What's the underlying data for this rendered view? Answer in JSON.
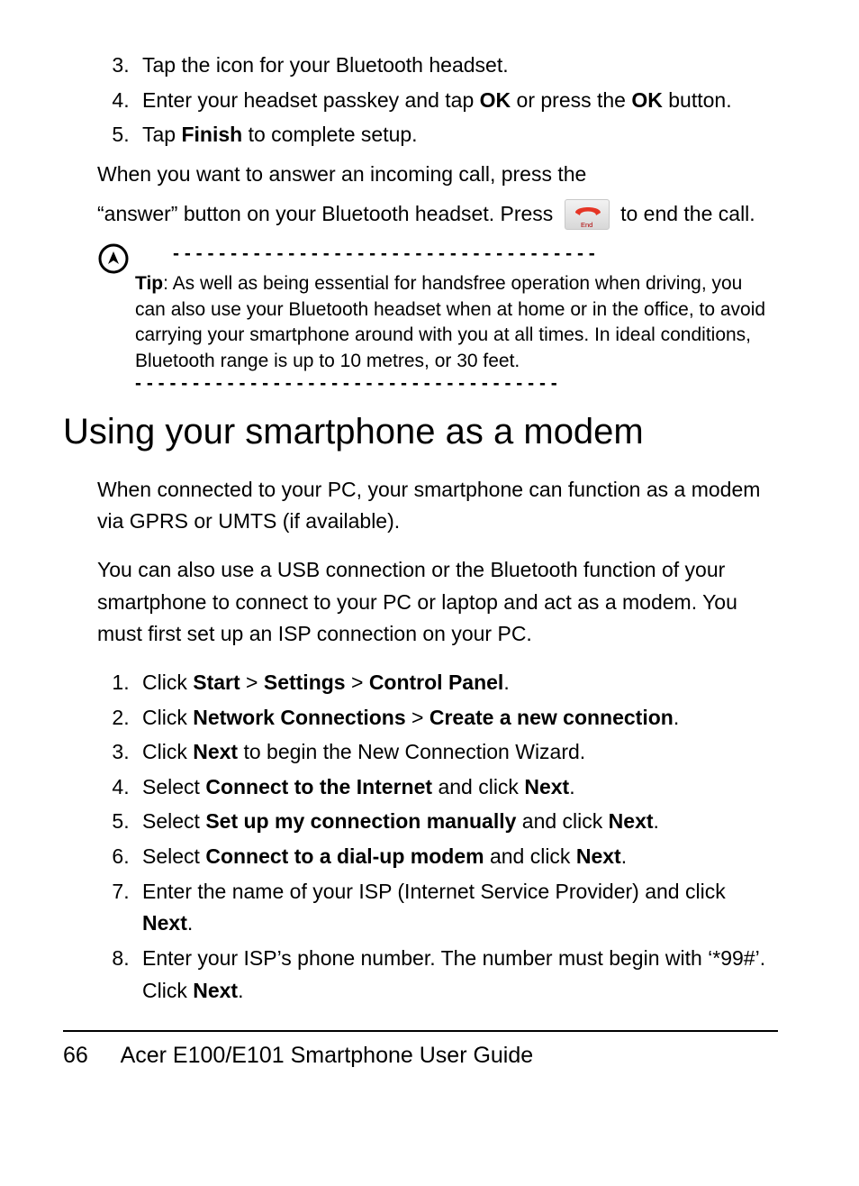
{
  "firstSteps": {
    "start": 3,
    "items": [
      {
        "pre": "Tap the icon for your Bluetooth headset.",
        "bolds": []
      },
      {
        "segments": [
          "Enter your headset passkey and tap ",
          {
            "b": "OK"
          },
          " or press the ",
          {
            "b": "OK"
          },
          " button."
        ]
      },
      {
        "segments": [
          "Tap ",
          {
            "b": "Finish"
          },
          " to complete setup."
        ]
      }
    ]
  },
  "answerPara1": "When you want to answer an incoming call, press the",
  "answerPara2a": "“answer” button on your Bluetooth headset. Press",
  "answerPara2b": "to end the call.",
  "endBtnLabel": "End",
  "tip": {
    "label": "Tip",
    "body": ": As well as being essential for handsfree operation when driving, you can also use your Bluetooth headset when at home or in the office, to avoid carrying your smartphone around with you at all times. In ideal conditions, Bluetooth range is up to 10 metres, or 30 feet.",
    "dashes": " - - - - - - - - - - - - - - - - - - - - - - - - - - - - - - - - - - - - -"
  },
  "heading": "Using your smartphone as a modem",
  "para1": "When connected to your PC, your smartphone can function as a modem via GPRS or UMTS (if available).",
  "para2": "You can also use a USB connection or the Bluetooth function of your smartphone to connect to your PC or laptop and act as a modem. You must first set up an ISP connection on your PC.",
  "modemSteps": [
    {
      "segments": [
        "Click ",
        {
          "b": "Start"
        },
        " > ",
        {
          "b": "Settings"
        },
        " > ",
        {
          "b": "Control Panel"
        },
        "."
      ]
    },
    {
      "segments": [
        "Click ",
        {
          "b": "Network Connections"
        },
        " > ",
        {
          "b": "Create a new connection"
        },
        "."
      ]
    },
    {
      "segments": [
        "Click ",
        {
          "b": "Next"
        },
        " to begin the New Connection Wizard."
      ]
    },
    {
      "segments": [
        "Select ",
        {
          "b": "Connect to the Internet"
        },
        " and click ",
        {
          "b": "Next"
        },
        "."
      ]
    },
    {
      "segments": [
        "Select ",
        {
          "b": "Set up my connection manually"
        },
        " and click ",
        {
          "b": "Next"
        },
        "."
      ]
    },
    {
      "segments": [
        "Select ",
        {
          "b": "Connect to a dial-up modem"
        },
        " and click ",
        {
          "b": "Next"
        },
        "."
      ]
    },
    {
      "segments": [
        "Enter the name of your ISP (Internet Service Provider) and click ",
        {
          "b": "Next"
        },
        "."
      ]
    },
    {
      "segments": [
        "Enter your ISP’s phone number. The number must begin with ‘*99#’. Click ",
        {
          "b": "Next"
        },
        "."
      ]
    }
  ],
  "footer": {
    "page": "66",
    "title": "Acer E100/E101 Smartphone User Guide"
  }
}
